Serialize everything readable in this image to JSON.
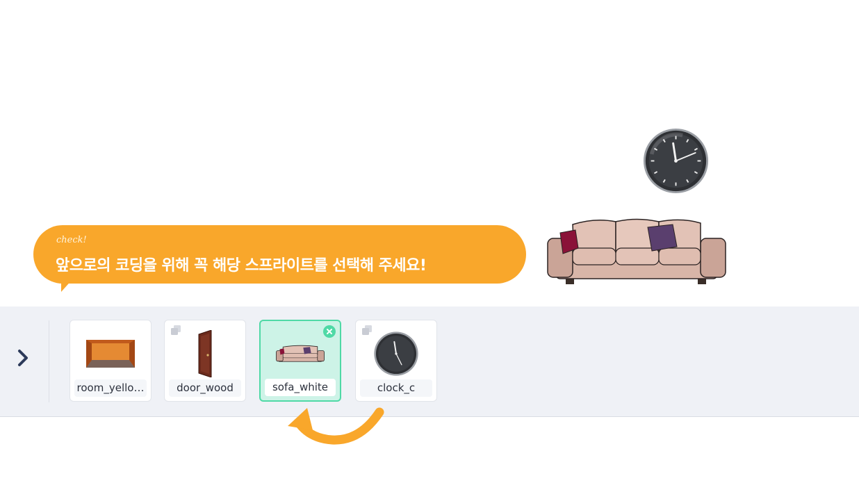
{
  "bubble": {
    "check": "check!",
    "text": "앞으로의 코딩을 위해 꼭 해당 스프라이트를 선택해 주세요!"
  },
  "colors": {
    "accent": "#f9a72b",
    "selected_bg": "#cdf3e7",
    "selected_border": "#4fd9a6",
    "panel_bg": "#eff1f6"
  },
  "sprites": [
    {
      "label": "room_yello…",
      "icon": "room-thumbnail",
      "selected": false
    },
    {
      "label": "door_wood",
      "icon": "door-thumbnail",
      "selected": false
    },
    {
      "label": "sofa_white",
      "icon": "sofa-thumbnail",
      "selected": true
    },
    {
      "label": "clock_c",
      "icon": "clock-thumbnail",
      "selected": false
    }
  ]
}
